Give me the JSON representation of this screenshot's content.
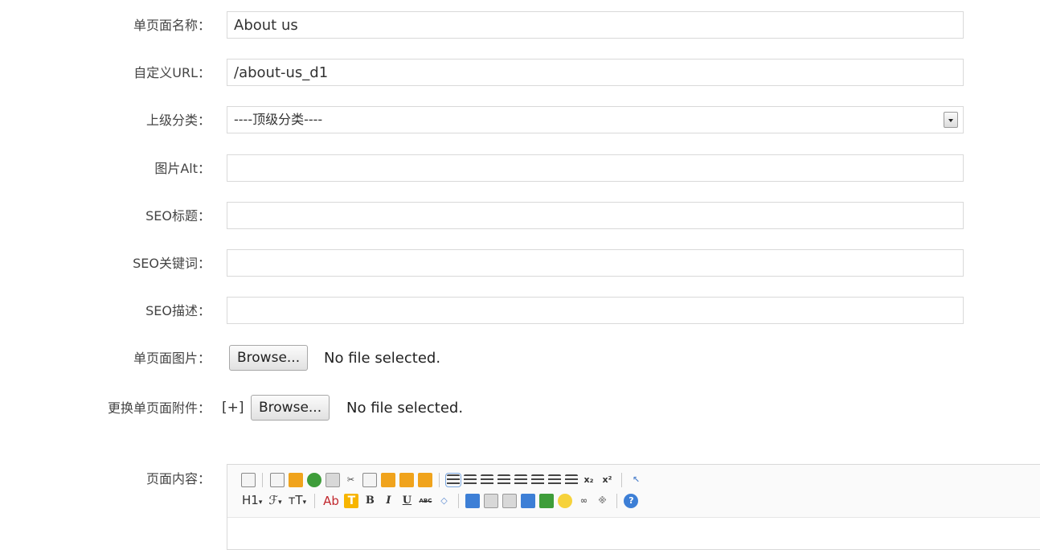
{
  "form": {
    "page_name": {
      "label": "单页面名称：",
      "value": "About us"
    },
    "custom_url": {
      "label": "自定义URL：",
      "value": "/about-us_d1"
    },
    "parent_category": {
      "label": "上级分类：",
      "selected": "----顶级分类----"
    },
    "image_alt": {
      "label": "图片Alt：",
      "value": ""
    },
    "seo_title": {
      "label": "SEO标题：",
      "value": ""
    },
    "seo_keywords": {
      "label": "SEO关键词：",
      "value": ""
    },
    "seo_description": {
      "label": "SEO描述：",
      "value": ""
    },
    "page_image": {
      "label": "单页面图片：",
      "button": "Browse...",
      "status": "No file selected."
    },
    "attachment": {
      "label": "更换单页面附件：",
      "add": "[+]",
      "button": "Browse...",
      "status": "No file selected."
    },
    "content": {
      "label": "页面内容：",
      "toolbar": {
        "heading_menu": "H1",
        "font_family_menu": "ℱ",
        "font_size_menu": "тT",
        "font_color_label": "Ab",
        "bg_color_label": "T",
        "bold": "B",
        "italic": "I",
        "underline": "U",
        "strike": "ABC",
        "subscript": "x₂",
        "superscript": "x²"
      }
    }
  },
  "colors": {
    "border": "#d9d9d9",
    "label_text": "#444444",
    "toolbar_bg": "#fafafa"
  }
}
